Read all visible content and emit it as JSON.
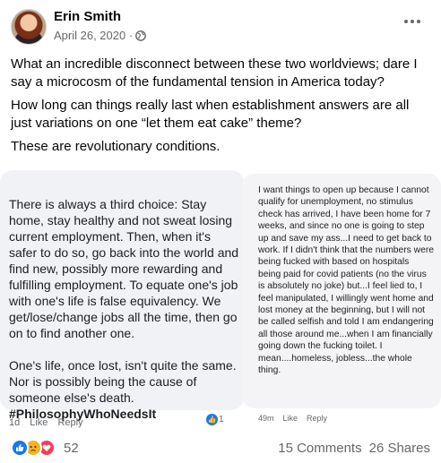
{
  "post": {
    "author": "Erin Smith",
    "date": "April 26, 2020 ·",
    "paragraphs": [
      "What an incredible disconnect between these two worldviews; dare I say a microcosm of the fundamental tension in America today?",
      "How long can things really last when establishment answers are all just variations on one “let them eat cake” theme?",
      "These are revolutionary conditions."
    ]
  },
  "image": {
    "left_comment": {
      "text": "There is always a third choice: Stay home, stay healthy and not sweat losing current employment. Then, when it's safer to do so, go back into the world and find new, possibly more rewarding and fulfilling employment. To equate one's job with one's life is false equivalency. We get/lose/change jobs all the time, then go on to find another one.\n\nOne's life, once lost, isn't quite the same. Nor is possibly being the cause of someone else's death.",
      "hashtag": "#PhilosophyWhoNeedsIt",
      "time": "1d",
      "like": "Like",
      "reply": "Reply",
      "reaction_count": "1"
    },
    "right_comment": {
      "text": "I want things to open up because I cannot qualify for unemployment, no stimulus check has arrived, I have been home for 7 weeks, and since no one is going to step up and save my ass...I need to get back to work. If I didn't think that the numbers were being fucked with based on hospitals being paid for covid patients (no the virus is absolutely no joke) but...I feel lied to, I feel manipulated, I willingly went home and lost money at the beginning, but I will not be called selfish and told I am endangering all those around me...when I am financially going down the fucking toilet. I mean....homeless, jobless...the whole thing.",
      "time": "49m",
      "like": "Like",
      "reply": "Reply"
    }
  },
  "footer": {
    "reaction_count": "52",
    "comments": "15 Comments",
    "shares": "26 Shares"
  },
  "colors": {
    "like": "#1877f2",
    "sad": "#f7b125",
    "love": "#f33e58",
    "secondary_text": "#65676b"
  },
  "icons": [
    "globe-icon",
    "more-options-icon",
    "like-reaction-icon",
    "sad-reaction-icon",
    "love-reaction-icon"
  ]
}
